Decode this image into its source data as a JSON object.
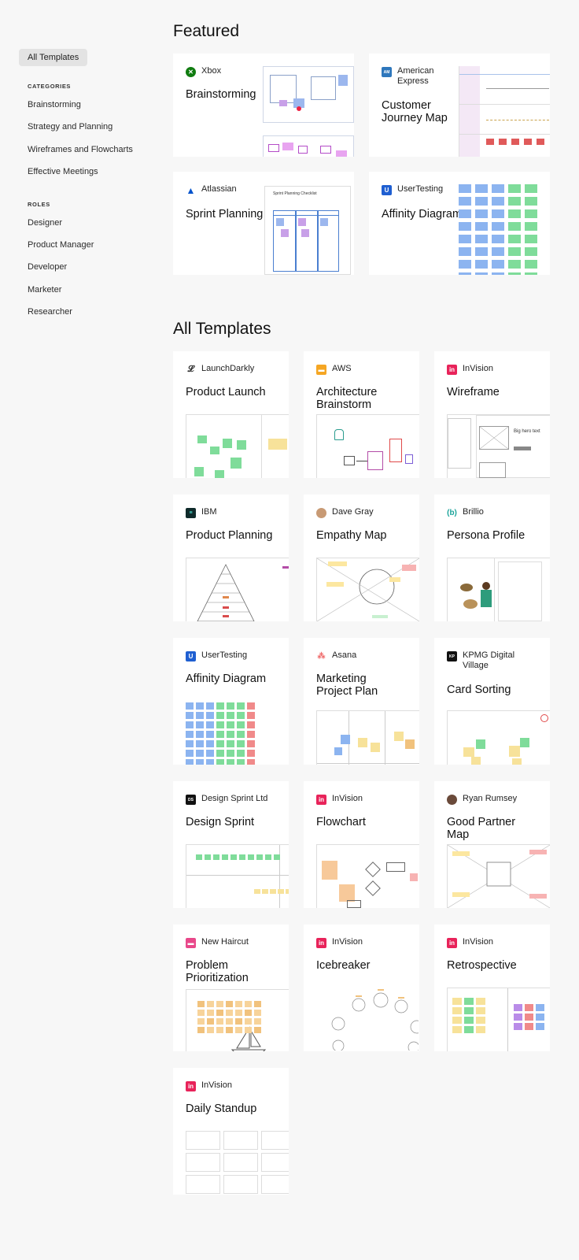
{
  "sidebar": {
    "all_templates": "All Templates",
    "categories_heading": "CATEGORIES",
    "categories": [
      "Brainstorming",
      "Strategy and Planning",
      "Wireframes and Flowcharts",
      "Effective Meetings"
    ],
    "roles_heading": "ROLES",
    "roles": [
      "Designer",
      "Product Manager",
      "Developer",
      "Marketer",
      "Researcher"
    ]
  },
  "featured": {
    "title": "Featured",
    "cards": [
      {
        "brand": "Xbox",
        "title": "Brainstorming",
        "logo": "xbox-logo"
      },
      {
        "brand": "American Express",
        "title": "Customer Journey Map",
        "logo": "amex-logo"
      },
      {
        "brand": "Atlassian",
        "title": "Sprint Planning",
        "logo": "atlassian-logo",
        "preview_text": "Sprint Planning Checklist"
      },
      {
        "brand": "UserTesting",
        "title": "Affinity Diagram",
        "logo": "usertesting-logo"
      }
    ]
  },
  "all": {
    "title": "All Templates",
    "cards": [
      {
        "brand": "LaunchDarkly",
        "title": "Product Launch"
      },
      {
        "brand": "AWS",
        "title": "Architecture Brainstorm"
      },
      {
        "brand": "InVision",
        "title": "Wireframe",
        "preview_text": "Big hero text"
      },
      {
        "brand": "IBM",
        "title": "Product Planning"
      },
      {
        "brand": "Dave Gray",
        "title": "Empathy Map"
      },
      {
        "brand": "Brillio",
        "title": "Persona Profile"
      },
      {
        "brand": "UserTesting",
        "title": "Affinity Diagram"
      },
      {
        "brand": "Asana",
        "title": "Marketing Project Plan"
      },
      {
        "brand": "KPMG Digital Village",
        "title": "Card Sorting"
      },
      {
        "brand": "Design Sprint Ltd",
        "title": "Design Sprint"
      },
      {
        "brand": "InVision",
        "title": "Flowchart"
      },
      {
        "brand": "Ryan Rumsey",
        "title": "Good Partner Map"
      },
      {
        "brand": "New Haircut",
        "title": "Problem Prioritization"
      },
      {
        "brand": "InVision",
        "title": "Icebreaker"
      },
      {
        "brand": "InVision",
        "title": "Retrospective"
      },
      {
        "brand": "InVision",
        "title": "Daily Standup"
      }
    ]
  },
  "colors": {
    "background": "#f7f7f7",
    "card": "#ffffff",
    "invision": "#e8235a",
    "xbox": "#107c10",
    "amex": "#2e77bc",
    "atlassian": "#0052cc",
    "usertesting": "#1f5fd1",
    "aws": "#f5a623",
    "brillio": "#1aa39a"
  }
}
